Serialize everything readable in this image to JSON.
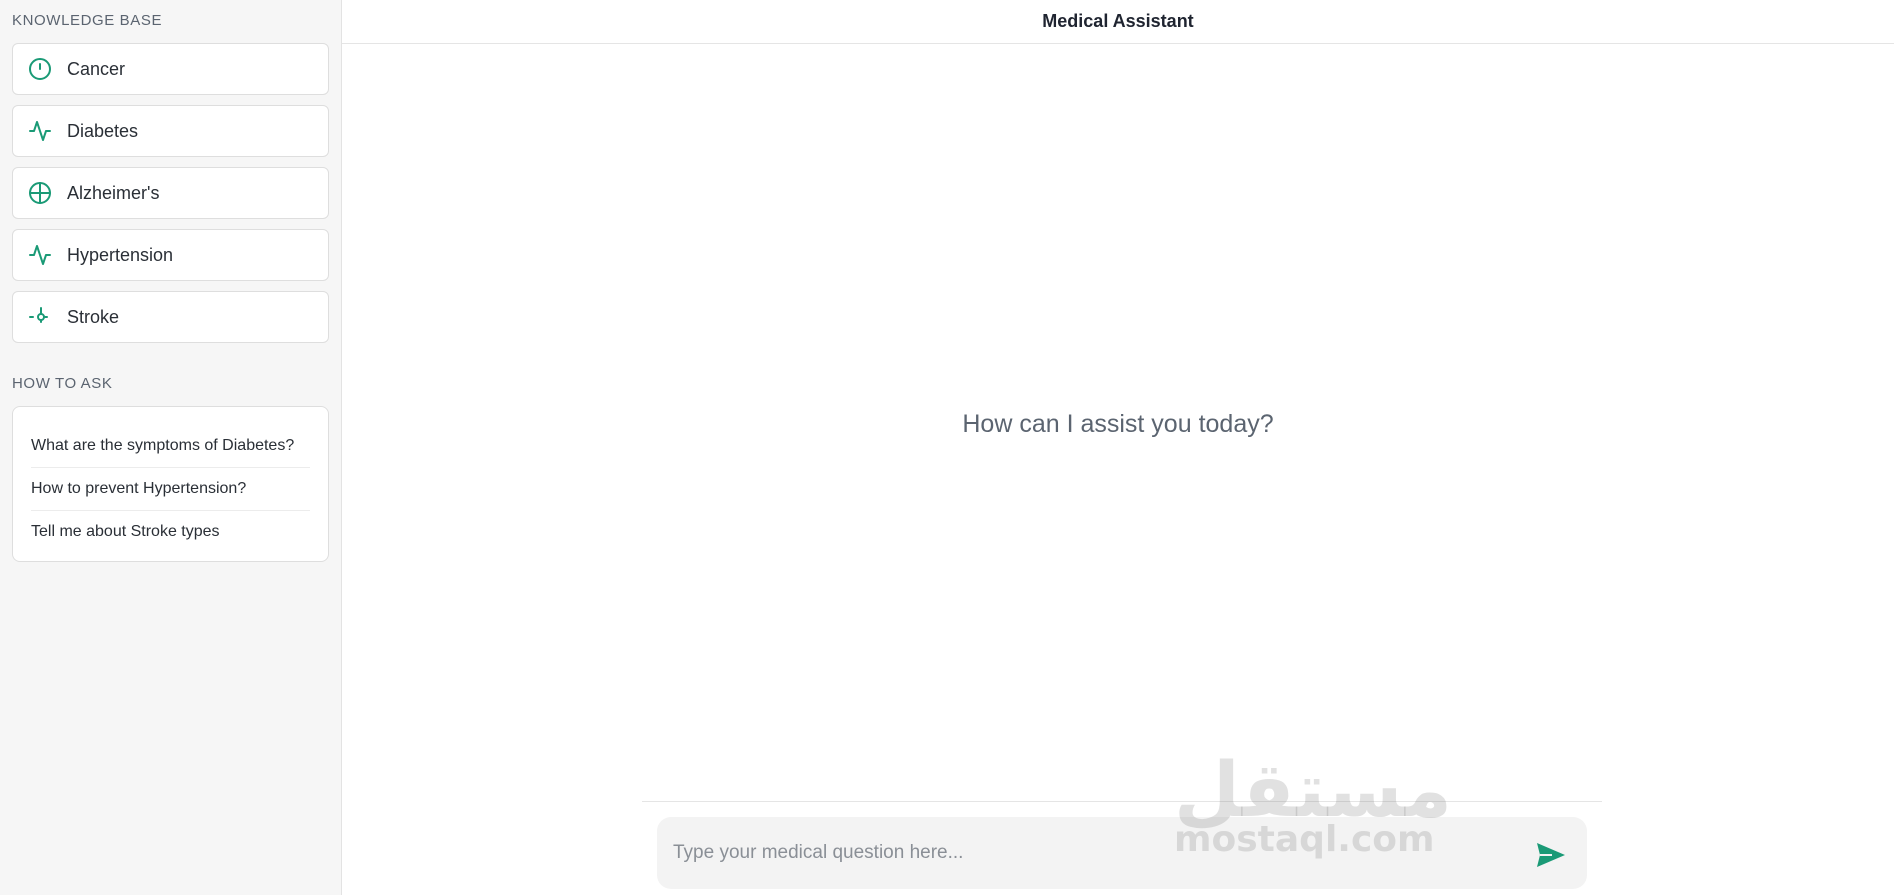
{
  "sidebar": {
    "knowledge_title": "KNOWLEDGE BASE",
    "items": [
      {
        "label": "Cancer",
        "icon": "alert-circle-icon"
      },
      {
        "label": "Diabetes",
        "icon": "activity-icon"
      },
      {
        "label": "Alzheimer's",
        "icon": "globe-crosshair-icon"
      },
      {
        "label": "Hypertension",
        "icon": "activity-icon"
      },
      {
        "label": "Stroke",
        "icon": "git-commit-icon"
      }
    ],
    "howto_title": "HOW TO ASK",
    "howto_items": [
      {
        "label": "What are the symptoms of Diabetes?"
      },
      {
        "label": "How to prevent Hypertension?"
      },
      {
        "label": "Tell me about Stroke types"
      }
    ]
  },
  "header": {
    "title": "Medical Assistant"
  },
  "main": {
    "welcome": "How can I assist you today?"
  },
  "composer": {
    "placeholder": "Type your medical question here...",
    "value": ""
  },
  "watermark": {
    "arabic": "مستقل",
    "latin": "mostaql.com"
  },
  "colors": {
    "accent": "#1a9a76",
    "sidebar_bg": "#f6f6f6",
    "composer_bg": "#f3f3f3"
  }
}
